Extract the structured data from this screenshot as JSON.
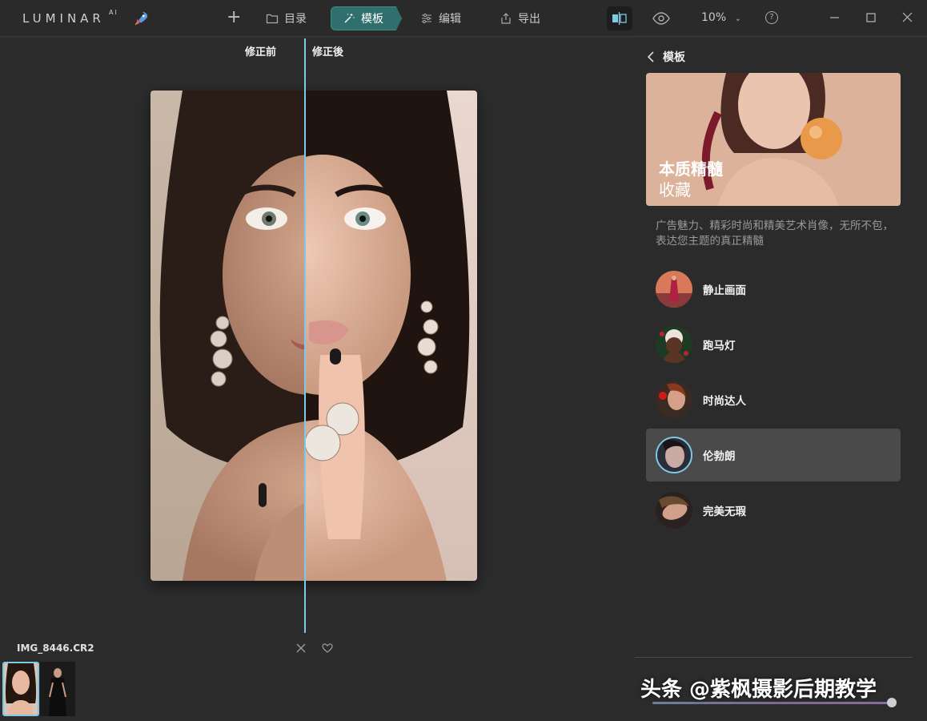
{
  "app": {
    "logo_text": "LUMINAR",
    "logo_suffix": "AI",
    "accent": "#7ec8e8",
    "active_tab_color": "#2f6f6e"
  },
  "nav": {
    "catalog_label": "目录",
    "templates_label": "模板",
    "edit_label": "编辑",
    "export_label": "导出"
  },
  "toolbar": {
    "zoom_value": "10%",
    "help_glyph": "?"
  },
  "canvas": {
    "before_label": "修正前",
    "after_label": "修正後",
    "split_position": 0.47
  },
  "filmstrip": {
    "filename": "IMG_8446.CR2"
  },
  "panel": {
    "back_label": "模板",
    "hero_title": "本质精髓",
    "hero_subtitle": "收藏",
    "description": "广告魅力、精彩时尚和精美艺术肖像，无所不包，表达您主题的真正精髓",
    "items": [
      {
        "label": "静止画面",
        "selected": false
      },
      {
        "label": "跑马灯",
        "selected": false
      },
      {
        "label": "时尚达人",
        "selected": false
      },
      {
        "label": "伦勃朗",
        "selected": true
      },
      {
        "label": "完美无瑕",
        "selected": false
      }
    ],
    "amount_slider_value": 1.0
  },
  "watermark": {
    "text": "头条 @紫枫摄影后期教学"
  }
}
